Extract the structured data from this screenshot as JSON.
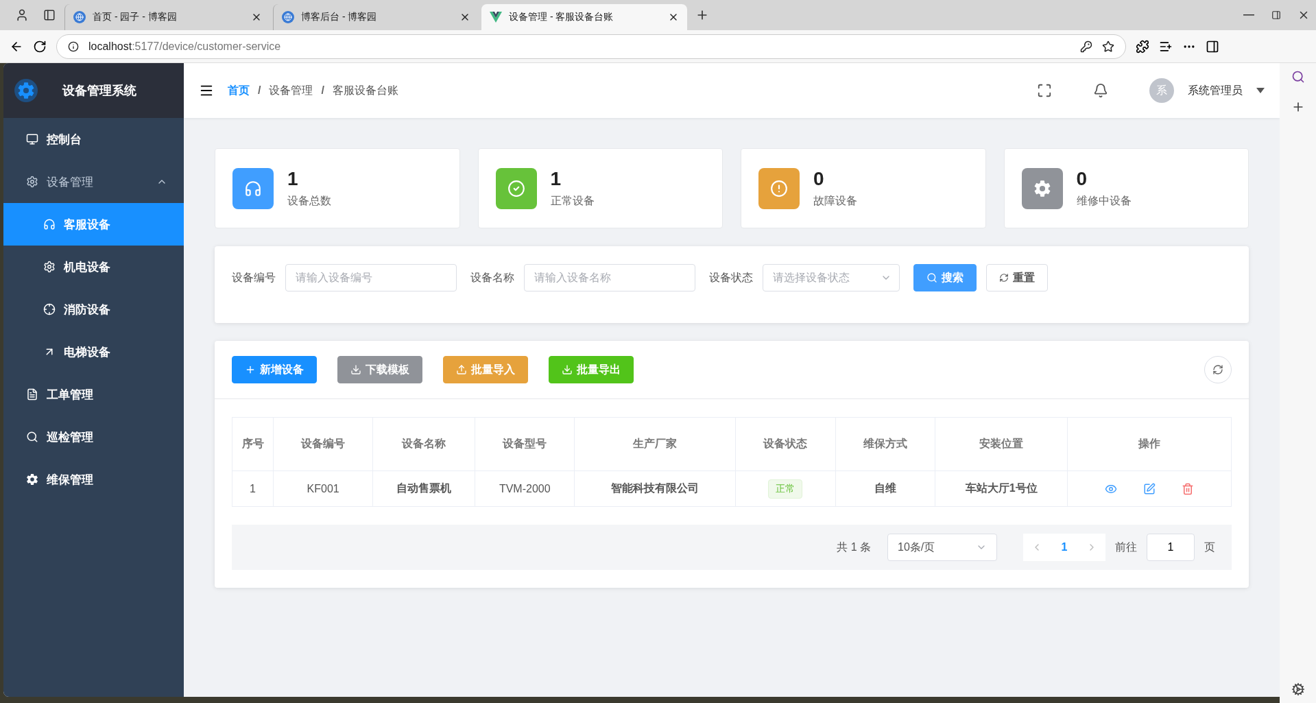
{
  "browser": {
    "tabs": [
      {
        "title": "首页 - 园子 - 博客园",
        "selected": false
      },
      {
        "title": "博客后台 - 博客园",
        "selected": false
      },
      {
        "title": "设备管理 - 客服设备台账",
        "selected": true
      }
    ],
    "url_host": "localhost",
    "url_rest": ":5177/device/customer-service"
  },
  "sidebar": {
    "title": "设备管理系统",
    "items": [
      {
        "label": "控制台",
        "selected": false
      },
      {
        "label": "设备管理",
        "selected": false,
        "expanded": true,
        "children": [
          {
            "label": "客服设备",
            "selected": true
          },
          {
            "label": "机电设备",
            "selected": false
          },
          {
            "label": "消防设备",
            "selected": false
          },
          {
            "label": "电梯设备",
            "selected": false
          }
        ]
      },
      {
        "label": "工单管理",
        "selected": false
      },
      {
        "label": "巡检管理",
        "selected": false
      },
      {
        "label": "维保管理",
        "selected": false
      }
    ]
  },
  "header": {
    "breadcrumb": [
      "首页",
      "设备管理",
      "客服设备台账"
    ],
    "separator": "/",
    "user_initial": "系",
    "user_name": "系统管理员"
  },
  "stats": [
    {
      "value": "1",
      "label": "设备总数",
      "color": "#409eff"
    },
    {
      "value": "1",
      "label": "正常设备",
      "color": "#67c23a"
    },
    {
      "value": "0",
      "label": "故障设备",
      "color": "#e6a23c"
    },
    {
      "value": "0",
      "label": "维修中设备",
      "color": "#909399"
    }
  ],
  "search": {
    "fields": [
      {
        "label": "设备编号",
        "placeholder": "请输入设备编号",
        "kind": "input"
      },
      {
        "label": "设备名称",
        "placeholder": "请输入设备名称",
        "kind": "input"
      },
      {
        "label": "设备状态",
        "placeholder": "请选择设备状态",
        "kind": "select"
      }
    ],
    "search_button": "搜索",
    "reset_button": "重置"
  },
  "toolbar": [
    {
      "label": "新增设备",
      "color": "#1890ff"
    },
    {
      "label": "下载模板",
      "color": "#909399"
    },
    {
      "label": "批量导入",
      "color": "#e6a23c"
    },
    {
      "label": "批量导出",
      "color": "#52c41a"
    }
  ],
  "table": {
    "columns": [
      "序号",
      "设备编号",
      "设备名称",
      "设备型号",
      "生产厂家",
      "设备状态",
      "维保方式",
      "安装位置",
      "操作"
    ],
    "rows": [
      {
        "index": "1",
        "code": "KF001",
        "name": "自动售票机",
        "model": "TVM-2000",
        "maker": "智能科技有限公司",
        "status": "正常",
        "maintenance": "自维",
        "location": "车站大厅1号位"
      }
    ]
  },
  "pagination": {
    "total": "共 1 条",
    "page_size": "10条/页",
    "pages": [
      {
        "label": "1",
        "selected": true
      }
    ],
    "goto_label": "前往",
    "goto_value": "1",
    "goto_suffix": "页"
  }
}
